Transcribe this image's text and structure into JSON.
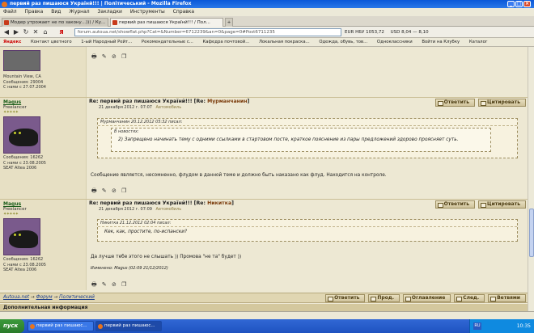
{
  "window": {
    "title": "первий раз пишаюся Українй!!! | Політичеський - Mozilla Firefox"
  },
  "menu": [
    "Файл",
    "Правка",
    "Вид",
    "Журнал",
    "Закладки",
    "Инструменты",
    "Справка"
  ],
  "tabs": [
    {
      "label": "Модер утрожает не по закону...))) / Ку..."
    },
    {
      "label": "первий раз пишаюся Українй!!! / Пол..."
    }
  ],
  "nav": {
    "url": "forum.autoua.net/showflat.php?Cat=&Number=6712239&an=0&page=0#Post6711235",
    "right_items": [
      "EUR НБУ 1053,72",
      "USD 8,04 — 8,10"
    ]
  },
  "bookmarks": [
    "Яндекс",
    "Контакт цветного",
    "1-ый Народный Рейт...",
    "Рекомендательные с...",
    "Кафедра почтовой...",
    "Локальная покраска...",
    "Одежда, обувь, тов...",
    "Одноклассники",
    "Войти на Клубку",
    "Каталог"
  ],
  "posts": [
    {
      "location": "Mountain View, CA",
      "posts_count": "Сообщения: 29004",
      "since": "С нами с 27.07.2004"
    },
    {
      "username": "Magus",
      "rank": "Freelancer",
      "stars": "✦✦✦✦✦",
      "posts_count": "Сообщения: 16262",
      "since": "С нами с 23.08.2005",
      "car": "SEAT Altea 2006",
      "title": "Re: первий раз пишаюся Українй!!! [Re: ",
      "quoted_user": "Мурманчанин",
      "title_end": "]",
      "date": "21 декабря 2012 г. 07:07",
      "date_status": "Автомобиль",
      "quote_head": "Мурманчанин 20.12.2012 05:32 писал:",
      "inner_quote_head": "В новостях:",
      "quote_text": "2) Запрещено начинать тему с одними ссылками в стартовом посте, краткое пояснение из пары предложений здорово проясняет суть.",
      "body": "Сообщение является, несомненно, флудом в данной теме и должно быть наказано как флуд. Находится на контроле."
    },
    {
      "username": "Magus",
      "rank": "Freelancer",
      "stars": "✦✦✦✦✦",
      "posts_count": "Сообщения: 16262",
      "since": "С нами с 23.08.2005",
      "car": "SEAT Altea 2006",
      "title": "Re: первий раз пишаюся Українй!!! [Re: ",
      "quoted_user": "Никитка",
      "title_end": "]",
      "date": "21 декабря 2012 г. 07:09",
      "date_status": "Автомобиль",
      "quote_head": "Никитка 21.12.2012 02:04 писал:",
      "quote_text": "Кек, как, простите, по-испански?",
      "body": "Да лучше тебе этого не слышать )) Промова \"не та\" будет ))",
      "edited": "Изменено: Magus (02:09 21/12/2012)"
    }
  ],
  "buttons": {
    "reply": "Ответить",
    "quote": "Цитировать"
  },
  "footer": {
    "crumb_site": "Autoua.net",
    "crumb_forum": "Форум",
    "crumb_section": "Политический",
    "sep": "→",
    "reply": "Ответить",
    "prev": "Прод.",
    "thread": "Оглавление",
    "next": "След.",
    "branches": "Ветвями"
  },
  "additional_info": "Дополнительная информация",
  "taskbar": {
    "start": "пуск",
    "item1": "первий раз пишаюс...",
    "item2": "первий раз пишаюс...",
    "lang": "RU",
    "clock": "10:35"
  }
}
